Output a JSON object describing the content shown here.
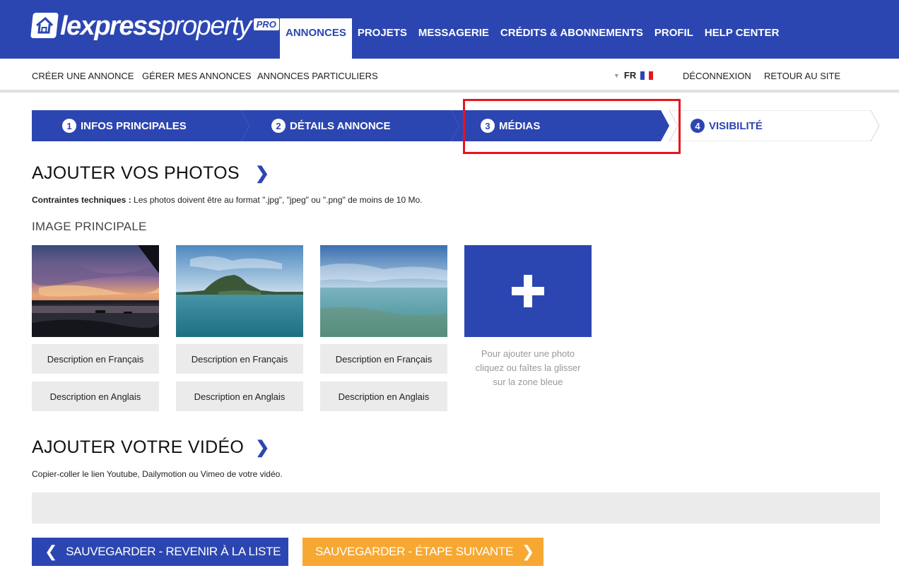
{
  "header": {
    "logo": {
      "bold": "lexpress",
      "light": "property",
      "badge": "PRO"
    },
    "nav": [
      {
        "label": "ANNONCES",
        "active": true
      },
      {
        "label": "PROJETS",
        "active": false
      },
      {
        "label": "MESSAGERIE",
        "active": false
      },
      {
        "label": "CRÉDITS & ABONNEMENTS",
        "active": false
      },
      {
        "label": "PROFIL",
        "active": false
      },
      {
        "label": "HELP CENTER",
        "active": false
      }
    ],
    "brand_color": "#2c46b1"
  },
  "subnav": {
    "items": [
      "CRÉER UNE ANNONCE",
      "GÉRER MES ANNONCES",
      "ANNONCES PARTICULIERS"
    ],
    "language": "FR",
    "logout": "DÉCONNEXION",
    "back_to_site": "RETOUR AU SITE"
  },
  "steps": [
    {
      "num": "1",
      "label": "INFOS PRINCIPALES",
      "active": true
    },
    {
      "num": "2",
      "label": "DÉTAILS ANNONCE",
      "active": true
    },
    {
      "num": "3",
      "label": "MÉDIAS",
      "active": true,
      "highlighted": true
    },
    {
      "num": "4",
      "label": "VISIBILITÉ",
      "active": false
    }
  ],
  "photos_section": {
    "title": "AJOUTER VOS PHOTOS",
    "constraints_label": "Contraintes techniques :",
    "constraints_text": " Les photos doivent être au format \".jpg\", \"jpeg\" ou \".png\" de moins de 10 Mo.",
    "main_image_label": "IMAGE PRINCIPALE",
    "photos": [
      {
        "image": "sunset-beach",
        "desc_fr": "Description en Français",
        "desc_en": "Description en Anglais"
      },
      {
        "image": "mountain-lagoon",
        "desc_fr": "Description en Français",
        "desc_en": "Description en Anglais"
      },
      {
        "image": "clear-lagoon",
        "desc_fr": "Description en Français",
        "desc_en": "Description en Anglais"
      }
    ],
    "add_hint": [
      "Pour ajouter une photo",
      "cliquez ou faîtes la glisser",
      "sur la zone bleue"
    ]
  },
  "video_section": {
    "title": "AJOUTER VOTRE VIDÉO",
    "help": "Copier-coller le lien Youtube, Dailymotion ou Vimeo de votre vidéo.",
    "value": ""
  },
  "buttons": {
    "back": "SAUVEGARDER - REVENIR À LA LISTE",
    "next": "SAUVEGARDER - ÉTAPE SUIVANTE",
    "next_color": "#f7a832"
  }
}
